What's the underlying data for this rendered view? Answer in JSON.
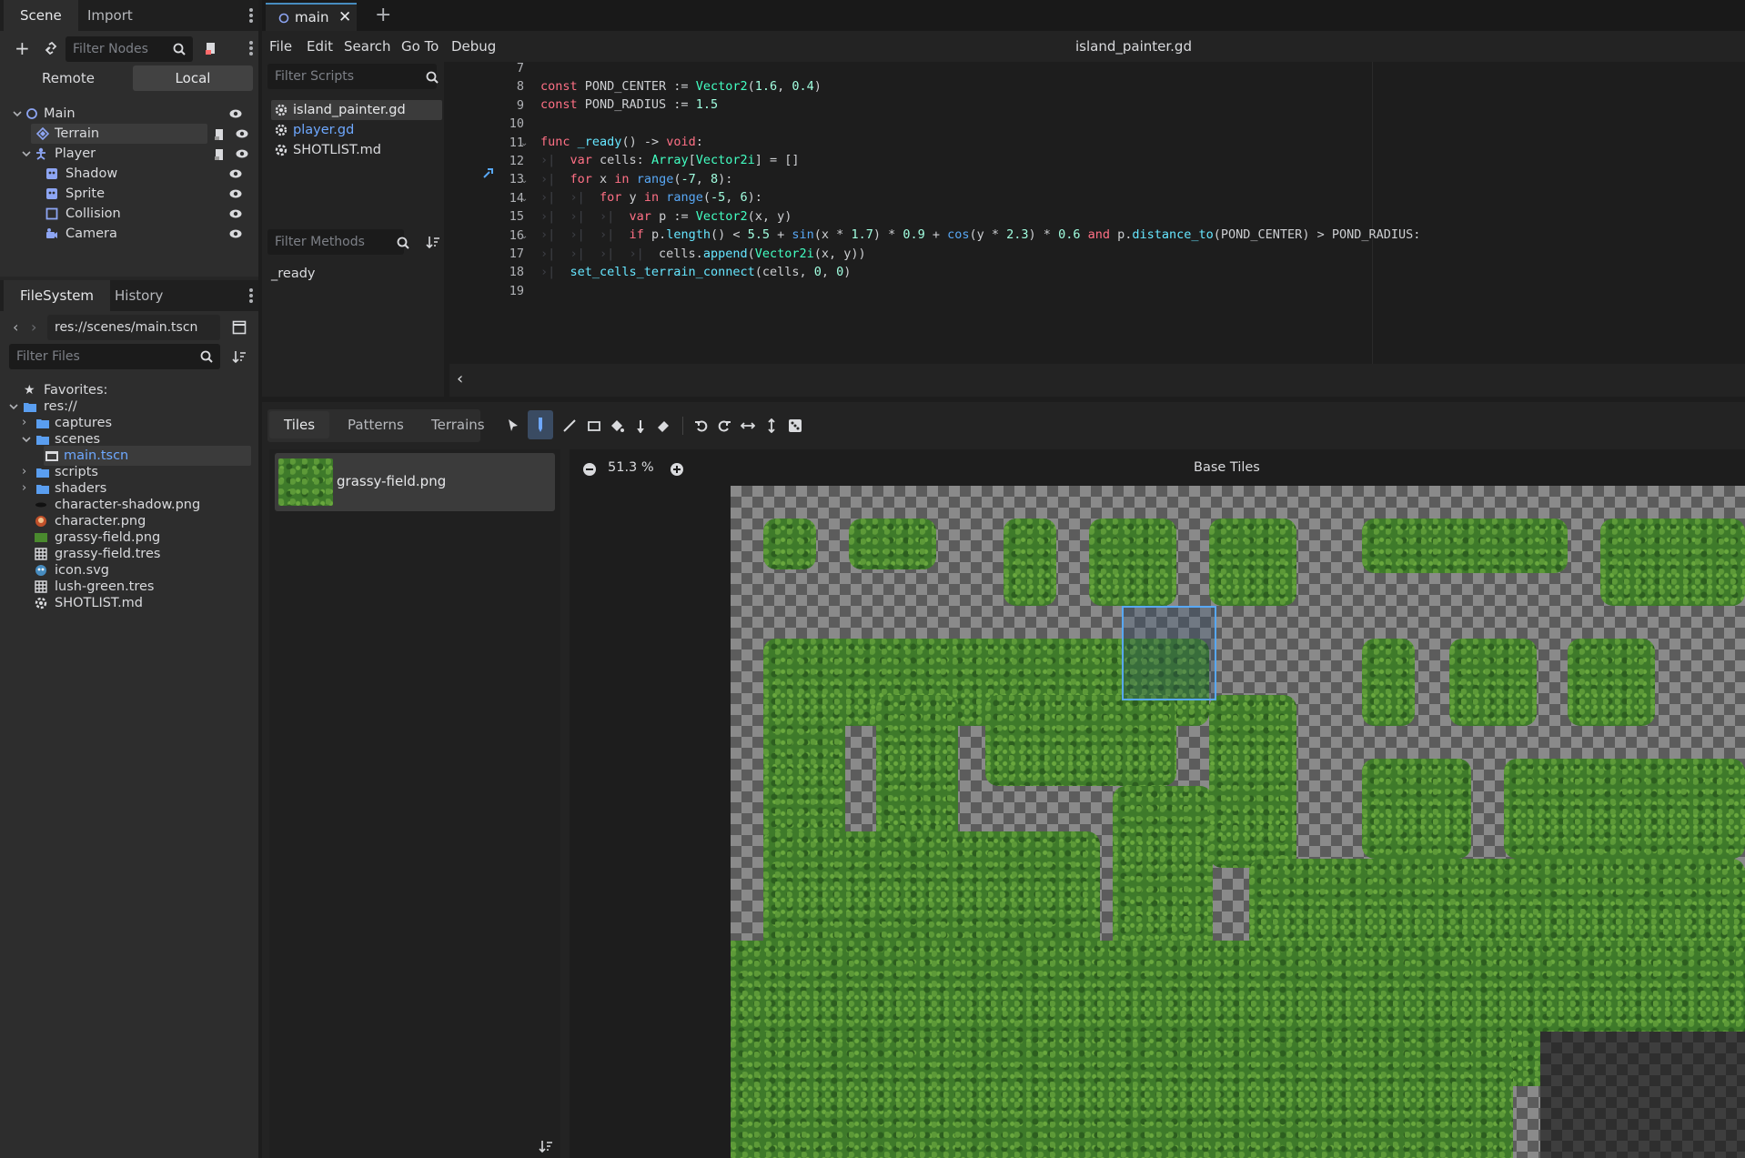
{
  "left_dock": {
    "scene_tabs": [
      "Scene",
      "Import"
    ],
    "filter_nodes_placeholder": "Filter Nodes",
    "remote_label": "Remote",
    "local_label": "Local",
    "nodes": [
      {
        "name": "Main",
        "icon": "node2d-icon"
      },
      {
        "name": "Terrain",
        "icon": "tilemap-layer-icon"
      },
      {
        "name": "Player",
        "icon": "character-body-icon"
      },
      {
        "name": "Shadow",
        "icon": "sprite-icon"
      },
      {
        "name": "Sprite",
        "icon": "sprite-icon"
      },
      {
        "name": "Collision",
        "icon": "collision-shape-icon"
      },
      {
        "name": "Camera",
        "icon": "camera-icon"
      }
    ],
    "fs_tabs": [
      "FileSystem",
      "History"
    ],
    "path": "res://scenes/main.tscn",
    "filter_files_placeholder": "Filter Files",
    "files": [
      "Favorites:",
      "res://",
      "captures",
      "scenes",
      "main.tscn",
      "scripts",
      "shaders",
      "character-shadow.png",
      "character.png",
      "grassy-field.png",
      "grassy-field.tres",
      "icon.svg",
      "lush-green.tres",
      "SHOTLIST.md"
    ]
  },
  "editor": {
    "tab_label": "main",
    "menus": [
      "File",
      "Edit",
      "Search",
      "Go To",
      "Debug"
    ],
    "script_title": "island_painter.gd",
    "filter_scripts_placeholder": "Filter Scripts",
    "scripts": [
      "island_painter.gd",
      "player.gd",
      "SHOTLIST.md"
    ],
    "filter_methods_placeholder": "Filter Methods",
    "methods": [
      "_ready"
    ],
    "line_numbers": [
      "7",
      "8",
      "9",
      "10",
      "11",
      "12",
      "13",
      "14",
      "15",
      "16",
      "17",
      "18",
      "19"
    ]
  },
  "bottom": {
    "tabs": [
      "Tiles",
      "Patterns",
      "Terrains"
    ],
    "atlas_source": "grassy-field.png",
    "zoom": "51.3 %",
    "canvas_title": "Base Tiles"
  },
  "colors": {
    "accent": "#478cbf",
    "keyword": "#ff7085",
    "type": "#42ffc2",
    "number": "#a1ffe0",
    "function": "#66e6ff"
  }
}
